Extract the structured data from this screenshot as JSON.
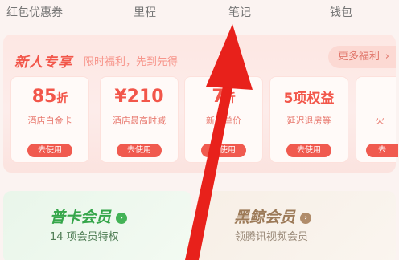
{
  "nav": {
    "tabs": [
      "红包优惠券",
      "里程",
      "笔记",
      "钱包"
    ]
  },
  "promo": {
    "title": "新人专享",
    "subtitle": "限时福利，先到先得",
    "more_label": "更多福利",
    "more_arrow": "›",
    "coupons": [
      {
        "value": "85",
        "unit": "折",
        "desc": "酒店白金卡",
        "button": "去使用"
      },
      {
        "value": "¥210",
        "unit": "",
        "desc": "酒店最高时减",
        "button": "去使用"
      },
      {
        "value": "7",
        "unit": "折",
        "desc": "新人单价",
        "button": "去使用"
      },
      {
        "value": "5项权益",
        "unit": "",
        "desc": "延迟退房等",
        "button": "去使用"
      },
      {
        "value": "",
        "unit": "",
        "desc": "火",
        "button": "去"
      }
    ]
  },
  "members": [
    {
      "title": "普卡会员",
      "subtitle": "14 项会员特权",
      "chevron": "›"
    },
    {
      "title": "黑鲸会员",
      "subtitle": "领腾讯视频会员",
      "chevron": "›"
    }
  ],
  "colors": {
    "accent_red": "#f2564a",
    "annotation_arrow": "#e8211b",
    "member_green": "#35a64a",
    "member_gold": "#9c7a58"
  }
}
